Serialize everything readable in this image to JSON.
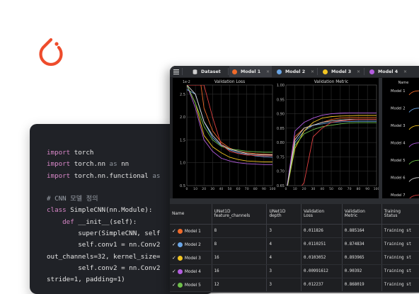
{
  "colors": {
    "brand": "#ee4c2c",
    "code_bg": "#202227",
    "app_bg": "#1e1f22"
  },
  "code": {
    "lines": [
      [
        {
          "t": "import",
          "c": "kw"
        },
        {
          "t": " torch",
          "c": "fn"
        }
      ],
      [
        {
          "t": "import",
          "c": "kw"
        },
        {
          "t": " torch.nn ",
          "c": "fn"
        },
        {
          "t": "as",
          "c": "dim"
        },
        {
          "t": " nn",
          "c": "fn"
        }
      ],
      [
        {
          "t": "import",
          "c": "kw"
        },
        {
          "t": " torch.nn.functional ",
          "c": "fn"
        },
        {
          "t": "as",
          "c": "dim"
        }
      ],
      [],
      [
        {
          "t": "# CNN 모델 정의",
          "c": "cm"
        }
      ],
      [
        {
          "t": "class",
          "c": "kw"
        },
        {
          "t": " SimpleCNN(nn.Module):",
          "c": "fn"
        }
      ],
      [
        {
          "t": "    def",
          "c": "kw"
        },
        {
          "t": " __init__(self):",
          "c": "fn"
        }
      ],
      [
        {
          "t": "        super(SimpleCNN, self",
          "c": "fn"
        }
      ],
      [
        {
          "t": "        self.conv1 = nn.Conv2",
          "c": "fn"
        }
      ],
      [
        {
          "t": "out_channels=32, kernel_size=",
          "c": "fn"
        }
      ],
      [
        {
          "t": "        self.conv2 = nn.Conv2",
          "c": "fn"
        }
      ],
      [
        {
          "t": "stride=1, padding=1)",
          "c": "fn"
        }
      ]
    ]
  },
  "tabs": [
    {
      "label": "Dataset",
      "icon": "database-icon",
      "color": "#cfcfcf"
    },
    {
      "label": "Model 1",
      "icon": "hexagon-icon",
      "color": "#f06a2a"
    },
    {
      "label": "Model 2",
      "icon": "hexagon-icon",
      "color": "#6aa6e6"
    },
    {
      "label": "Model 3",
      "icon": "hexagon-icon",
      "color": "#f2c522"
    },
    {
      "label": "Model 4",
      "icon": "hexagon-icon",
      "color": "#b45de0"
    }
  ],
  "chart_data": [
    {
      "type": "line",
      "title": "Validation Loss",
      "y_exponent_label": "1e-2",
      "x": [
        0,
        10,
        20,
        30,
        40,
        50,
        60,
        70,
        80,
        90,
        100
      ],
      "xlim": [
        0,
        100
      ],
      "ylim": [
        0.5,
        2.7
      ],
      "yticks": [
        0.5,
        1.0,
        1.5,
        2.0,
        2.5
      ],
      "series": [
        {
          "color": "#f06a2a",
          "values": [
            8.0,
            3.6,
            2.2,
            1.7,
            1.45,
            1.32,
            1.25,
            1.22,
            1.2,
            1.19,
            1.18
          ]
        },
        {
          "color": "#6aa6e6",
          "values": [
            2.6,
            2.5,
            1.9,
            1.55,
            1.38,
            1.28,
            1.22,
            1.18,
            1.15,
            1.13,
            1.12
          ]
        },
        {
          "color": "#f2c522",
          "values": [
            2.7,
            2.3,
            1.6,
            1.35,
            1.22,
            1.12,
            1.07,
            1.04,
            1.03,
            1.02,
            1.02
          ]
        },
        {
          "color": "#b45de0",
          "values": [
            2.7,
            2.2,
            1.5,
            1.25,
            1.1,
            1.04,
            1.0,
            0.98,
            0.97,
            0.96,
            0.96
          ]
        },
        {
          "color": "#6ec04a",
          "values": [
            2.7,
            2.3,
            1.8,
            1.5,
            1.36,
            1.3,
            1.28,
            1.25,
            1.24,
            1.23,
            1.23
          ]
        },
        {
          "color": "#d8d8d8",
          "values": [
            2.7,
            2.5,
            1.9,
            1.6,
            1.4,
            1.3,
            1.25,
            1.2,
            1.18,
            1.17,
            1.17
          ]
        },
        {
          "color": "#e04040",
          "values": [
            2.7,
            2.7,
            2.7,
            2.0,
            1.4,
            1.25,
            1.2,
            1.17,
            1.16,
            1.15,
            1.15
          ]
        }
      ]
    },
    {
      "type": "line",
      "title": "Validation Metric",
      "x": [
        0,
        10,
        20,
        30,
        40,
        50,
        60,
        70,
        80,
        90,
        100
      ],
      "xlim": [
        0,
        100
      ],
      "ylim": [
        0.65,
        1.0
      ],
      "yticks": [
        0.65,
        0.7,
        0.75,
        0.8,
        0.85,
        0.9,
        0.95,
        1.0
      ],
      "series": [
        {
          "color": "#f06a2a",
          "values": [
            0.62,
            0.82,
            0.85,
            0.86,
            0.87,
            0.88,
            0.885,
            0.886,
            0.886,
            0.886,
            0.886
          ]
        },
        {
          "color": "#6aa6e6",
          "values": [
            0.62,
            0.8,
            0.84,
            0.86,
            0.865,
            0.87,
            0.872,
            0.873,
            0.874,
            0.874,
            0.874
          ]
        },
        {
          "color": "#f2c522",
          "values": [
            0.62,
            0.78,
            0.84,
            0.87,
            0.885,
            0.89,
            0.892,
            0.893,
            0.894,
            0.894,
            0.894
          ]
        },
        {
          "color": "#b45de0",
          "values": [
            0.62,
            0.84,
            0.87,
            0.885,
            0.895,
            0.9,
            0.902,
            0.903,
            0.903,
            0.903,
            0.903
          ]
        },
        {
          "color": "#6ec04a",
          "values": [
            0.62,
            0.79,
            0.83,
            0.845,
            0.855,
            0.86,
            0.865,
            0.868,
            0.869,
            0.869,
            0.869
          ]
        },
        {
          "color": "#d8d8d8",
          "values": [
            0.62,
            0.81,
            0.85,
            0.86,
            0.87,
            0.875,
            0.878,
            0.88,
            0.88,
            0.88,
            0.88
          ]
        },
        {
          "color": "#e04040",
          "values": [
            0.62,
            0.62,
            0.66,
            0.82,
            0.85,
            0.87,
            0.875,
            0.878,
            0.88,
            0.88,
            0.88
          ]
        }
      ]
    }
  ],
  "side_panel": {
    "title": "Name",
    "items": [
      "Model 1",
      "Model 2",
      "Model 3",
      "Model 4",
      "Model 5",
      "Model 6",
      "Model 7"
    ]
  },
  "table": {
    "headers": [
      "Name",
      "UNet1D\nfeature_channels",
      "UNet1D\ndepth",
      "Validation\nLoss",
      "Validation\nMetric",
      "Training\nStatus"
    ],
    "rows": [
      {
        "name": "Model 1",
        "color": "#f06a2a",
        "fc": "8",
        "depth": "3",
        "loss": "0.011826",
        "metric": "0.885164",
        "status": "Training st"
      },
      {
        "name": "Model 2",
        "color": "#6aa6e6",
        "fc": "8",
        "depth": "4",
        "loss": "0.0110251",
        "metric": "0.874834",
        "status": "Training st"
      },
      {
        "name": "Model 3",
        "color": "#f2c522",
        "fc": "16",
        "depth": "4",
        "loss": "0.0103052",
        "metric": "0.893965",
        "status": "Training st"
      },
      {
        "name": "Model 4",
        "color": "#b45de0",
        "fc": "16",
        "depth": "3",
        "loss": "0.00991612",
        "metric": "0.90392",
        "status": "Training st"
      },
      {
        "name": "Model 5",
        "color": "#6ec04a",
        "fc": "12",
        "depth": "3",
        "loss": "0.012237",
        "metric": "0.868019",
        "status": "Training st"
      }
    ]
  }
}
